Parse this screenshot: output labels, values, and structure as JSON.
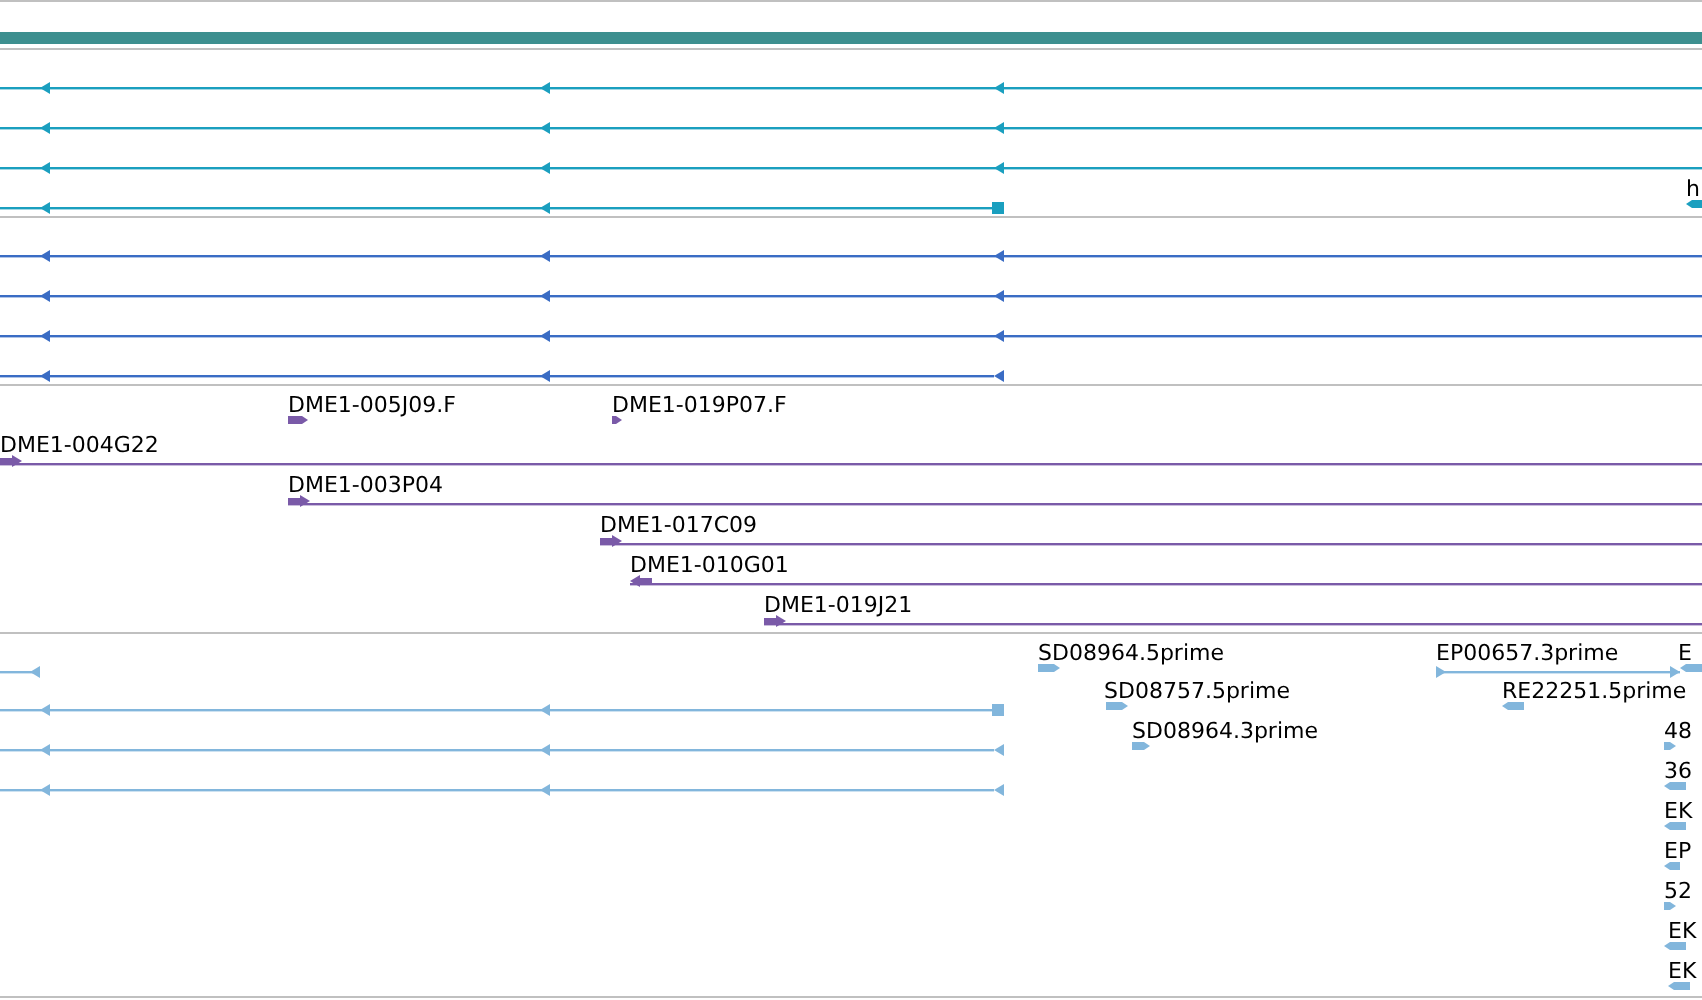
{
  "tracks": [
    {
      "kind": "bar",
      "color": "#3d8f8f"
    },
    {
      "kind": "features",
      "color": "#1a9fbf",
      "features": [
        {
          "reverse": true
        },
        {
          "reverse": true
        },
        {
          "reverse": true
        },
        {
          "reverse": true
        },
        {
          "reverse": true,
          "label": "h"
        }
      ]
    },
    {
      "kind": "features",
      "color": "#3a6cc4",
      "features": [
        {
          "reverse": true
        },
        {
          "reverse": true
        },
        {
          "reverse": true
        },
        {
          "reverse": true
        }
      ]
    },
    {
      "kind": "features",
      "color": "#7a5aa8",
      "features": [
        {
          "reverse": false,
          "label": "DME1-005J09.F"
        },
        {
          "reverse": false,
          "label": "DME1-019P07.F"
        },
        {
          "reverse": false,
          "label": "DME1-004G22"
        },
        {
          "reverse": false,
          "label": "DME1-003P04"
        },
        {
          "reverse": false,
          "label": "DME1-017C09"
        },
        {
          "reverse": true,
          "label": "DME1-010G01"
        },
        {
          "reverse": false,
          "label": "DME1-019J21"
        }
      ]
    },
    {
      "kind": "features",
      "color": "#82b6dc",
      "features": [
        {
          "reverse": true
        },
        {
          "reverse": false,
          "label": "SD08964.5prime"
        },
        {
          "reverse": false,
          "label": "EP00657.3prime"
        },
        {
          "reverse": true,
          "label": "E"
        },
        {
          "reverse": true
        },
        {
          "reverse": false,
          "label": "SD08757.5prime"
        },
        {
          "reverse": true,
          "label": "RE22251.5prime"
        },
        {
          "reverse": true
        },
        {
          "reverse": false,
          "label": "SD08964.3prime"
        },
        {
          "reverse": false,
          "label": "48"
        },
        {
          "reverse": true
        },
        {
          "reverse": true,
          "label": "36"
        },
        {
          "reverse": true,
          "label": "EK"
        },
        {
          "reverse": true,
          "label": "EP"
        },
        {
          "reverse": false,
          "label": "52"
        },
        {
          "reverse": true,
          "label": "EK"
        },
        {
          "reverse": true,
          "label": "EK"
        }
      ]
    }
  ]
}
